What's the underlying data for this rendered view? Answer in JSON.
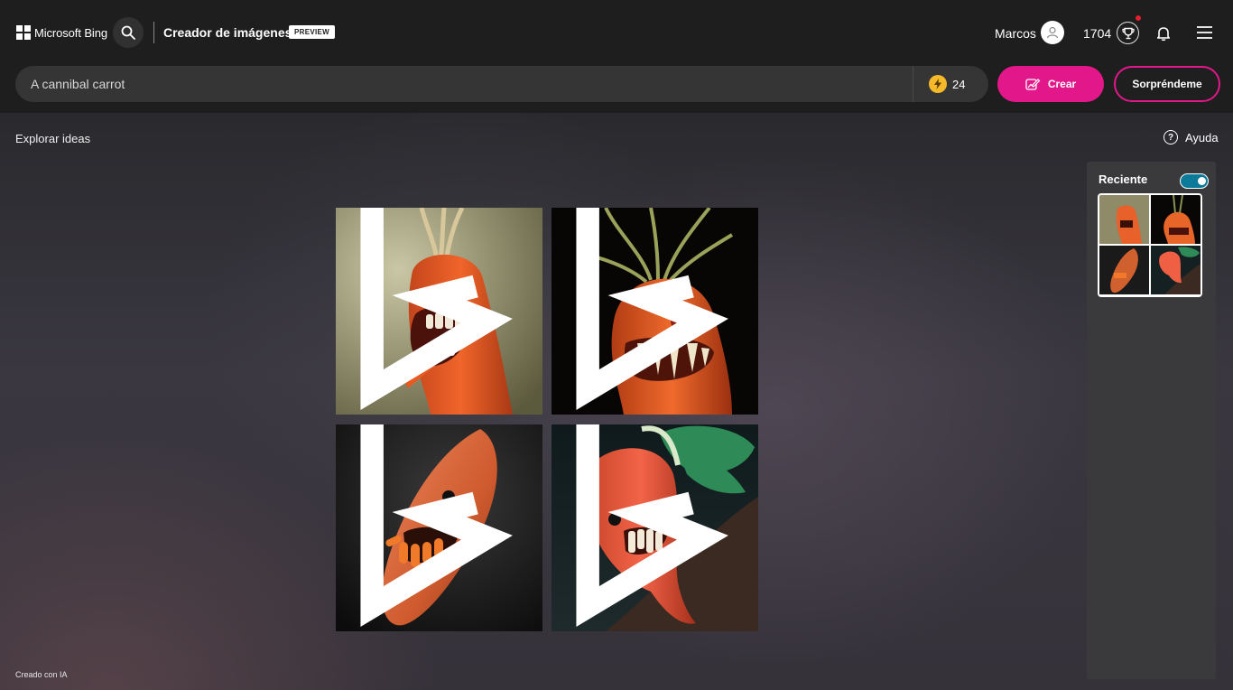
{
  "header": {
    "logo_text": "Microsoft Bing",
    "title": "Creador de imágenes",
    "badge": "PREVIEW",
    "user_name": "Marcos",
    "points": "1704"
  },
  "prompt": {
    "value": "A cannibal carrot",
    "boosts": "24",
    "create_label": "Crear",
    "surprise_label": "Sorpréndeme"
  },
  "explore_label": "Explorar ideas",
  "help_label": "Ayuda",
  "recent": {
    "title": "Reciente",
    "toggle_on": true
  },
  "footer": {
    "created_label": "Creado con IA"
  },
  "colors": {
    "accent": "#e2178a",
    "boost": "#f5b92a",
    "toggle": "#0e7a9a"
  },
  "images": [
    {
      "name": "carrot-image-1"
    },
    {
      "name": "carrot-image-2"
    },
    {
      "name": "carrot-image-3"
    },
    {
      "name": "carrot-image-4"
    }
  ]
}
